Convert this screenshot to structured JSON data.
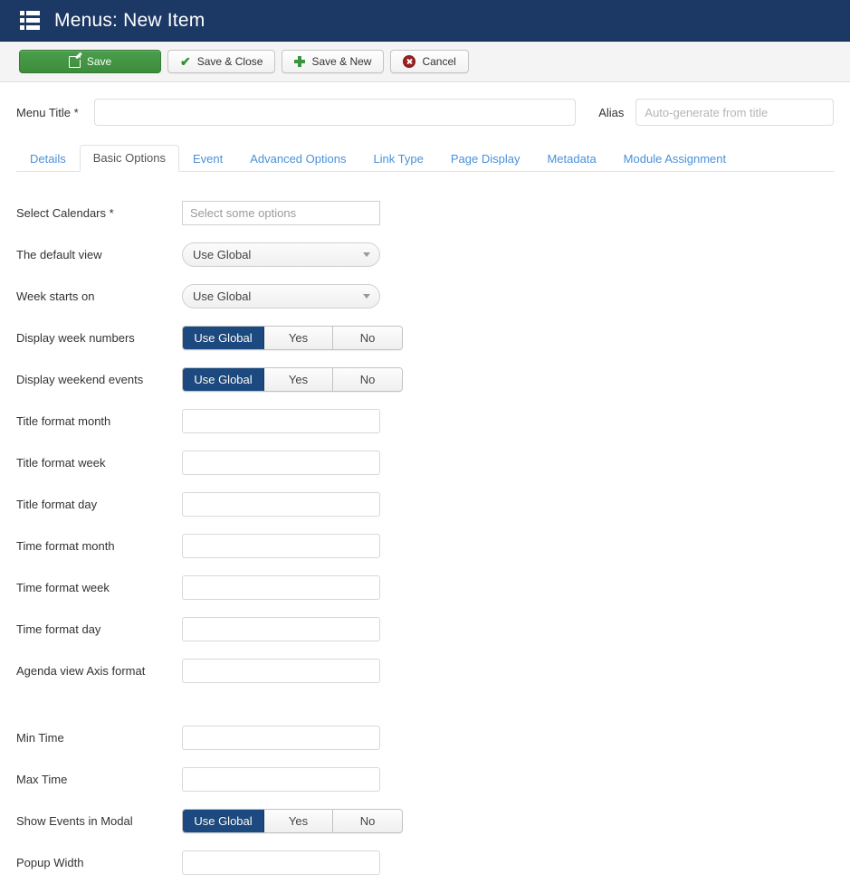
{
  "header": {
    "title": "Menus: New Item",
    "icon": "menu-grid-icon",
    "bg_color": "#1c3864"
  },
  "toolbar": {
    "buttons": [
      {
        "label": "Save",
        "icon": "pencil-icon",
        "style": "primary-green"
      },
      {
        "label": "Save & Close",
        "icon": "check-icon",
        "style": "default"
      },
      {
        "label": "Save & New",
        "icon": "plus-icon",
        "style": "default"
      },
      {
        "label": "Cancel",
        "icon": "cancel-icon",
        "style": "default"
      }
    ]
  },
  "title_row": {
    "menu_title_label": "Menu Title *",
    "menu_title_value": "",
    "menu_title_placeholder": "",
    "alias_label": "Alias",
    "alias_value": "",
    "alias_placeholder": "Auto-generate from title"
  },
  "tabs": [
    {
      "label": "Details",
      "active": false
    },
    {
      "label": "Basic Options",
      "active": true
    },
    {
      "label": "Event",
      "active": false
    },
    {
      "label": "Advanced Options",
      "active": false
    },
    {
      "label": "Link Type",
      "active": false
    },
    {
      "label": "Page Display",
      "active": false
    },
    {
      "label": "Metadata",
      "active": false
    },
    {
      "label": "Module Assignment",
      "active": false
    }
  ],
  "fields": [
    {
      "label": "Select Calendars *",
      "type": "multiselect",
      "placeholder": "Select some options",
      "value": ""
    },
    {
      "label": "The default view",
      "type": "select",
      "value": "Use Global"
    },
    {
      "label": "Week starts on",
      "type": "select",
      "value": "Use Global"
    },
    {
      "label": "Display week numbers",
      "type": "radio-group",
      "options": [
        "Use Global",
        "Yes",
        "No"
      ],
      "selected": "Use Global"
    },
    {
      "label": "Display weekend events",
      "type": "radio-group",
      "options": [
        "Use Global",
        "Yes",
        "No"
      ],
      "selected": "Use Global"
    },
    {
      "label": "Title format month",
      "type": "text",
      "value": ""
    },
    {
      "label": "Title format week",
      "type": "text",
      "value": ""
    },
    {
      "label": "Title format day",
      "type": "text",
      "value": ""
    },
    {
      "label": "Time format month",
      "type": "text",
      "value": ""
    },
    {
      "label": "Time format week",
      "type": "text",
      "value": ""
    },
    {
      "label": "Time format day",
      "type": "text",
      "value": ""
    },
    {
      "label": "Agenda view Axis format",
      "type": "text",
      "value": ""
    },
    {
      "label": "",
      "type": "spacer"
    },
    {
      "label": "Min Time",
      "type": "text",
      "value": ""
    },
    {
      "label": "Max Time",
      "type": "text",
      "value": ""
    },
    {
      "label": "Show Events in Modal",
      "type": "radio-group",
      "options": [
        "Use Global",
        "Yes",
        "No"
      ],
      "selected": "Use Global"
    },
    {
      "label": "Popup Width",
      "type": "text",
      "value": ""
    }
  ],
  "colors": {
    "header_bg": "#1c3864",
    "save_green": "#3d8c3d",
    "active_segment": "#1c4a80",
    "tab_link": "#4a90d9"
  }
}
